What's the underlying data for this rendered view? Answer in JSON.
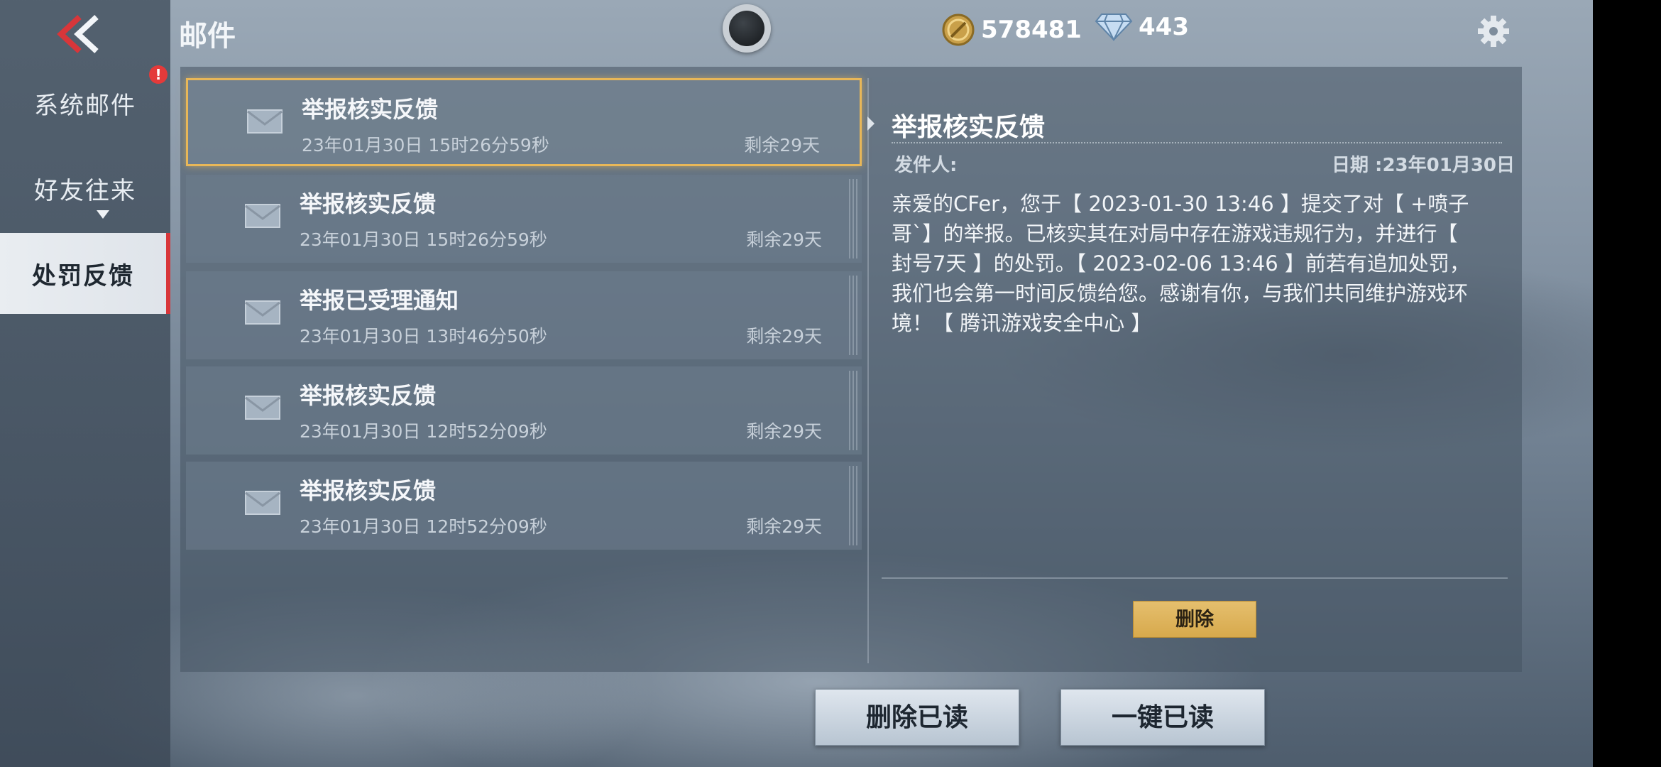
{
  "header": {
    "title": "邮件",
    "coins": "578481",
    "diamonds": "443"
  },
  "sidebar": {
    "items": [
      {
        "label": "系统邮件",
        "badge": "!"
      },
      {
        "label": "好友往来"
      },
      {
        "label": "处罚反馈",
        "active": true
      }
    ]
  },
  "mails": [
    {
      "title": "举报核实反馈",
      "date": "23年01月30日 15时26分59秒",
      "remain": "剩余29天",
      "selected": true
    },
    {
      "title": "举报核实反馈",
      "date": "23年01月30日 15时26分59秒",
      "remain": "剩余29天"
    },
    {
      "title": "举报已受理通知",
      "date": "23年01月30日 13时46分50秒",
      "remain": "剩余29天"
    },
    {
      "title": "举报核实反馈",
      "date": "23年01月30日 12时52分09秒",
      "remain": "剩余29天"
    },
    {
      "title": "举报核实反馈",
      "date": "23年01月30日 12时52分09秒",
      "remain": "剩余29天"
    }
  ],
  "detail": {
    "title": "举报核实反馈",
    "sender_label": "发件人:",
    "date_label": "日期 :23年01月30日",
    "body_lines": [
      "亲爱的CFer，您于【 2023-01-30 13:46 】提交了对【 +喷子",
      "哥`】的举报。已核实其在对局中存在游戏违规行为，并进行【",
      "封号7天 】的处罚。【 2023-02-06 13:46 】前若有追加处罚，",
      "我们也会第一时间反馈给您。感谢有你，与我们共同维护游戏环",
      "境！【 腾讯游戏安全中心 】"
    ],
    "delete_label": "删除"
  },
  "footer": {
    "delete_read": "删除已读",
    "mark_all_read": "一键已读"
  },
  "colors": {
    "accent_gold": "#e8b758",
    "active_red": "#d8363a"
  }
}
